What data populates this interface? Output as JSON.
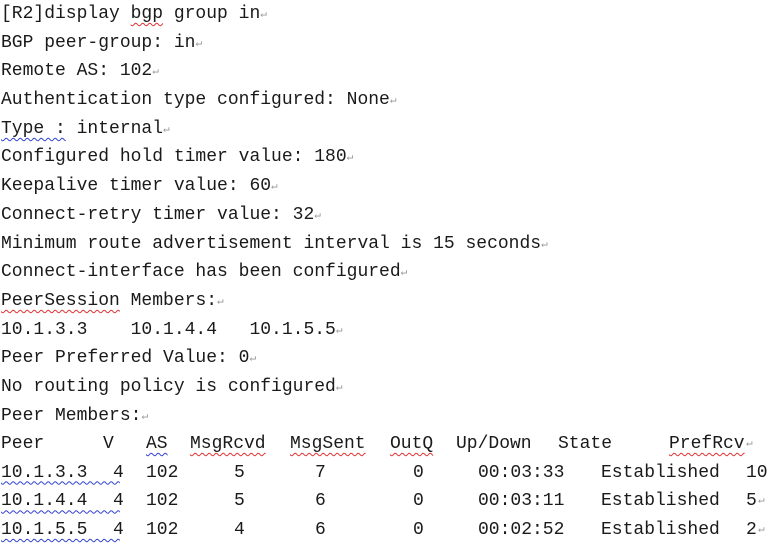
{
  "lines": [
    {
      "pre": "[R2]display ",
      "flag": "bgp",
      "flag_style": "red",
      "post": " group in"
    },
    {
      "pre": "BGP peer-group: in",
      "flag": "",
      "flag_style": "",
      "post": ""
    },
    {
      "pre": "Remote AS: 102",
      "flag": "",
      "flag_style": "",
      "post": ""
    },
    {
      "pre": "Authentication type configured: None",
      "flag": "",
      "flag_style": "",
      "post": ""
    },
    {
      "pre": "",
      "flag": "Type :",
      "flag_style": "blue",
      "post": " internal"
    },
    {
      "pre": "Configured hold timer value: 180",
      "flag": "",
      "flag_style": "",
      "post": ""
    },
    {
      "pre": "Keepalive timer value: 60",
      "flag": "",
      "flag_style": "",
      "post": ""
    },
    {
      "pre": "Connect-retry timer value: 32",
      "flag": "",
      "flag_style": "",
      "post": ""
    },
    {
      "pre": "Minimum route advertisement interval is 15 seconds",
      "flag": "",
      "flag_style": "",
      "post": ""
    },
    {
      "pre": "Connect-interface has been configured",
      "flag": "",
      "flag_style": "",
      "post": ""
    },
    {
      "pre": "",
      "flag": "PeerSession",
      "flag_style": "red",
      "post": " Members:"
    },
    {
      "pre": "10.1.3.3    10.1.4.4   10.1.5.5",
      "flag": "",
      "flag_style": "",
      "post": ""
    },
    {
      "pre": "Peer Preferred Value: 0",
      "flag": "",
      "flag_style": "",
      "post": ""
    },
    {
      "pre": "No routing policy is configured",
      "flag": "",
      "flag_style": "",
      "post": ""
    },
    {
      "pre": "Peer Members:",
      "flag": "",
      "flag_style": "",
      "post": ""
    }
  ],
  "paragraph_mark": "↵",
  "peer_table": {
    "headers": [
      "Peer",
      "V",
      "AS",
      "MsgRcvd",
      "MsgSent",
      "OutQ",
      "Up/Down",
      "State",
      "PrefRcv"
    ],
    "rows": [
      {
        "peer": "10.1.3.3",
        "v": "4",
        "as": "102",
        "msgrcvd": "5",
        "msgsent": "7",
        "outq": "0",
        "updown": "00:03:33",
        "state": "Established",
        "prefrcv": "10"
      },
      {
        "peer": "10.1.4.4",
        "v": "4",
        "as": "102",
        "msgrcvd": "5",
        "msgsent": "6",
        "outq": "0",
        "updown": "00:03:11",
        "state": "Established",
        "prefrcv": "5"
      },
      {
        "peer": "10.1.5.5",
        "v": "4",
        "as": "102",
        "msgrcvd": "4",
        "msgsent": "6",
        "outq": "0",
        "updown": "00:02:52",
        "state": "Established",
        "prefrcv": "2"
      }
    ]
  },
  "colors": {
    "spell_red": "#e03030",
    "grammar_blue": "#3040d0",
    "text": "#1a1a1a"
  }
}
